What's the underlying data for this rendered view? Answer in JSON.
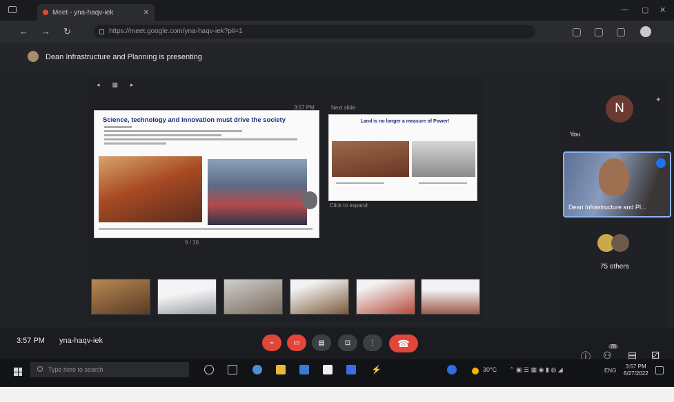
{
  "browser": {
    "tab_title": "Meet - yna-haqv-iek",
    "url": "https://meet.google.com/yna-haqv-iek?pli=1"
  },
  "presenting": {
    "text": "Dean Infrastructure and Planning is presenting"
  },
  "stage": {
    "time_label": "3:57 PM",
    "next_label": "Next slide",
    "click_to_expand": "Click to expand",
    "page_indicator": "9 / 38"
  },
  "slide_main": {
    "title": "Science, technology and innovation must drive the society"
  },
  "slide_next": {
    "title": "Land is no longer a measure of Power!"
  },
  "participants": {
    "you_initial": "N",
    "you_label": "You",
    "presenter_name": "Dean Infrastructure and Pl...",
    "others_label": "75 others"
  },
  "meeting": {
    "time": "3:57 PM",
    "code": "yna-haqv-iek",
    "people_count": "78"
  },
  "taskbar": {
    "search_placeholder": "Type here to search",
    "weather": "30°C",
    "language": "ENG",
    "clock_time": "3:57 PM",
    "clock_date": "6/27/2022"
  },
  "colors": {
    "accent_red": "#e2453a",
    "accent_blue": "#8ab4f8",
    "slide_title_blue": "#1c2a7a"
  },
  "icons": [
    "window-icon",
    "reload-icon",
    "lock-icon",
    "mic-off-icon",
    "camera-off-icon",
    "captions-icon",
    "present-icon",
    "more-icon",
    "hangup-icon",
    "info-icon",
    "people-icon",
    "chat-icon",
    "activities-icon",
    "windows-start-icon",
    "search-icon",
    "pin-icon"
  ]
}
